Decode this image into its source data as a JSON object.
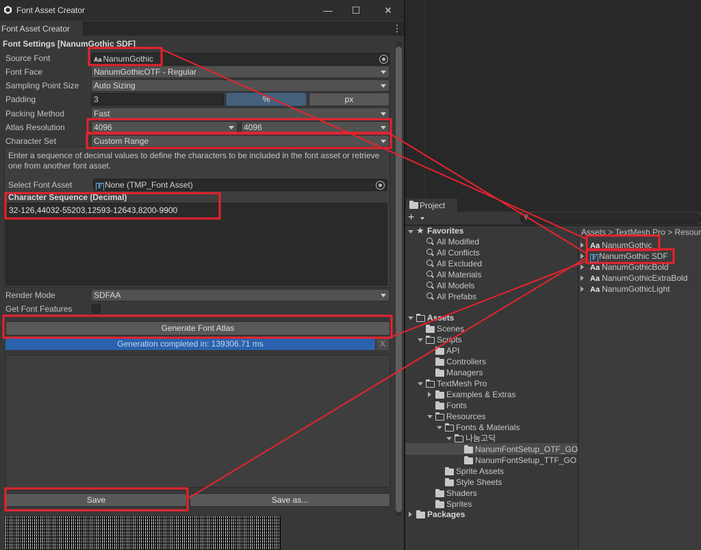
{
  "window": {
    "title": "Font Asset Creator",
    "minimize_icon": "minimize-icon",
    "maximize_icon": "maximize-icon",
    "close_icon": "close-icon"
  },
  "tab": {
    "label": "Font Asset Creator",
    "menu_icon": "kebab-menu-icon"
  },
  "font_settings": {
    "section_title": "Font Settings [NanumGothic SDF]",
    "source_font": {
      "label": "Source Font",
      "value": "NanumGothic",
      "icon": "font-asset-icon"
    },
    "font_face": {
      "label": "Font Face",
      "value": "NanumGothicOTF - Regular"
    },
    "sampling_point_size": {
      "label": "Sampling Point Size",
      "value": "Auto Sizing"
    },
    "padding": {
      "label": "Padding",
      "value": "3",
      "unit_percent": "%",
      "unit_px": "px"
    },
    "packing_method": {
      "label": "Packing Method",
      "value": "Fast"
    },
    "atlas_resolution": {
      "label": "Atlas Resolution",
      "width": "4096",
      "height": "4096"
    },
    "character_set": {
      "label": "Character Set",
      "value": "Custom Range"
    },
    "help_text": "Enter a sequence of decimal values to define the characters to be included in the font asset or retrieve one from another font asset.",
    "select_font_asset": {
      "label": "Select Font Asset",
      "value": "None (TMP_Font Asset)"
    },
    "character_sequence": {
      "label": "Character Sequence (Decimal)",
      "value": "32-126,44032-55203,12593-12643,8200-9900"
    },
    "render_mode": {
      "label": "Render Mode",
      "value": "SDFAA"
    },
    "get_font_features": {
      "label": "Get Font Features",
      "checked": false
    }
  },
  "actions": {
    "generate_label": "Generate Font Atlas",
    "progress_text": "Generation completed in: 139306.71 ms",
    "progress_fraction": 1.0,
    "progress_close": "X",
    "save_label": "Save",
    "save_as_label": "Save as..."
  },
  "project": {
    "tab_label": "Project",
    "add_label": "+",
    "search_placeholder": "",
    "breadcrumb": "Assets > TextMesh Pro > Resources",
    "favorites": {
      "label": "Favorites",
      "items": [
        "All Modified",
        "All Conflicts",
        "All Excluded",
        "All Materials",
        "All Models",
        "All Prefabs"
      ]
    },
    "assets_tree": {
      "assets": "Assets",
      "scenes": "Scenes",
      "scripts": "Scripts",
      "api": "API",
      "controllers": "Controllers",
      "managers": "Managers",
      "textmesh_pro": "TextMesh Pro",
      "examples": "Examples & Extras",
      "fonts": "Fonts",
      "resources": "Resources",
      "fonts_materials": "Fonts & Materials",
      "nanum_folder": "나눔고딕",
      "setup_otf": "NanumFontSetup_OTF_GO",
      "setup_ttf": "NanumFontSetup_TTF_GO",
      "sprite_assets": "Sprite Assets",
      "style_sheets": "Style Sheets",
      "shaders": "Shaders",
      "sprites": "Sprites",
      "packages": "Packages"
    },
    "asset_list": [
      {
        "name": "NanumGothic",
        "icon": "Aa"
      },
      {
        "name": "NanumGothic SDF",
        "icon": "F"
      },
      {
        "name": "NanumGothicBold",
        "icon": "Aa"
      },
      {
        "name": "NanumGothicExtraBold",
        "icon": "Aa"
      },
      {
        "name": "NanumGothicLight",
        "icon": "Aa"
      }
    ]
  },
  "colors": {
    "annotation_red": "#e8232e",
    "progress_blue": "#2a62ad",
    "active_button": "#46607c"
  }
}
